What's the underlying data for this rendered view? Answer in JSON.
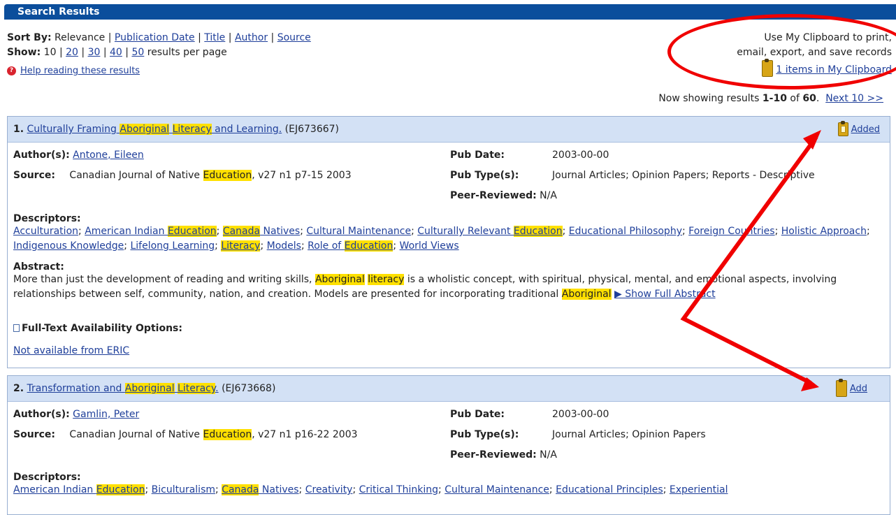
{
  "header": {
    "title": "Search Results"
  },
  "controls": {
    "sort_label": "Sort By:",
    "sort_current": "Relevance",
    "sort_options": [
      "Publication Date",
      "Title",
      "Author",
      "Source"
    ],
    "show_label": "Show:",
    "show_current": "10",
    "show_options": [
      "20",
      "30",
      "40",
      "50"
    ],
    "show_suffix": "results per page",
    "separator": "|",
    "help_link": "Help reading these results"
  },
  "clipboard": {
    "line1": "Use My Clipboard to print,",
    "line2": "email, export, and save records",
    "link": "1 items in My Clipboard"
  },
  "results_summary": {
    "prefix": "Now showing results",
    "range": "1-10",
    "of": "of",
    "total": "60",
    "period": ".",
    "next": "Next 10 >>"
  },
  "records": [
    {
      "number": "1.",
      "title_parts": [
        "Culturally Framing ",
        "Aboriginal",
        " ",
        "Literacy",
        " and Learning."
      ],
      "id": "(EJ673667)",
      "clip_action": "Added",
      "author_label": "Author(s):",
      "author": "Antone, Eileen",
      "source_label": "Source:",
      "source_pre": "Canadian Journal of Native ",
      "source_hl": "Education",
      "source_post": ", v27 n1 p7-15 2003",
      "pub_date_label": "Pub Date:",
      "pub_date": "2003-00-00",
      "pub_type_label": "Pub Type(s):",
      "pub_type": "Journal Articles; Opinion Papers; Reports - Descriptive",
      "peer_label": "Peer-Reviewed:",
      "peer": "N/A",
      "descriptors_label": "Descriptors:",
      "abstract_label": "Abstract:",
      "abstract_1": "More than just the development of reading and writing skills, ",
      "abstract_hl1": "Aboriginal",
      "abstract_hl2": "literacy",
      "abstract_2": " is a wholistic concept, with spiritual, physical, mental, and emotional aspects, involving relationships between self, community, nation, and creation. Models are presented for incorporating traditional ",
      "abstract_hl3": "Aboriginal",
      "show_link": "▶ Show Full Abstract",
      "fulltext_label": "Full-Text Availability Options:",
      "fulltext_link": "Not available from ERIC"
    },
    {
      "number": "2.",
      "title_parts": [
        "Transformation and ",
        "Aboriginal",
        " ",
        "Literacy",
        "."
      ],
      "id": "(EJ673668)",
      "clip_action": "Add",
      "author_label": "Author(s):",
      "author": "Gamlin, Peter",
      "source_label": "Source:",
      "source_pre": "Canadian Journal of Native ",
      "source_hl": "Education",
      "source_post": ", v27 n1 p16-22 2003",
      "pub_date_label": "Pub Date:",
      "pub_date": "2003-00-00",
      "pub_type_label": "Pub Type(s):",
      "pub_type": "Journal Articles; Opinion Papers",
      "peer_label": "Peer-Reviewed:",
      "peer": "N/A",
      "descriptors_label": "Descriptors:"
    }
  ],
  "descriptors_1": [
    "Acculturation",
    "American Indian ",
    "Education",
    "Canada",
    " Natives",
    "Cultural Maintenance",
    "Culturally Relevant ",
    "Education",
    "Educational Philosophy",
    "Foreign Countries",
    "Holistic Approach",
    "Indigenous Knowledge",
    "Lifelong Learning",
    "Literacy",
    "Models",
    "Role of ",
    "Education",
    "World Views",
    "; "
  ],
  "descriptors_2": [
    "American Indian ",
    "Education",
    "Biculturalism",
    "Canada",
    " Natives",
    "Creativity",
    "Critical Thinking",
    "Cultural Maintenance",
    "Educational Principles",
    "Experiential"
  ],
  "annotation_color": "#f00000",
  "highlight_color": "#ffe000",
  "header_color": "#0b4e9c"
}
